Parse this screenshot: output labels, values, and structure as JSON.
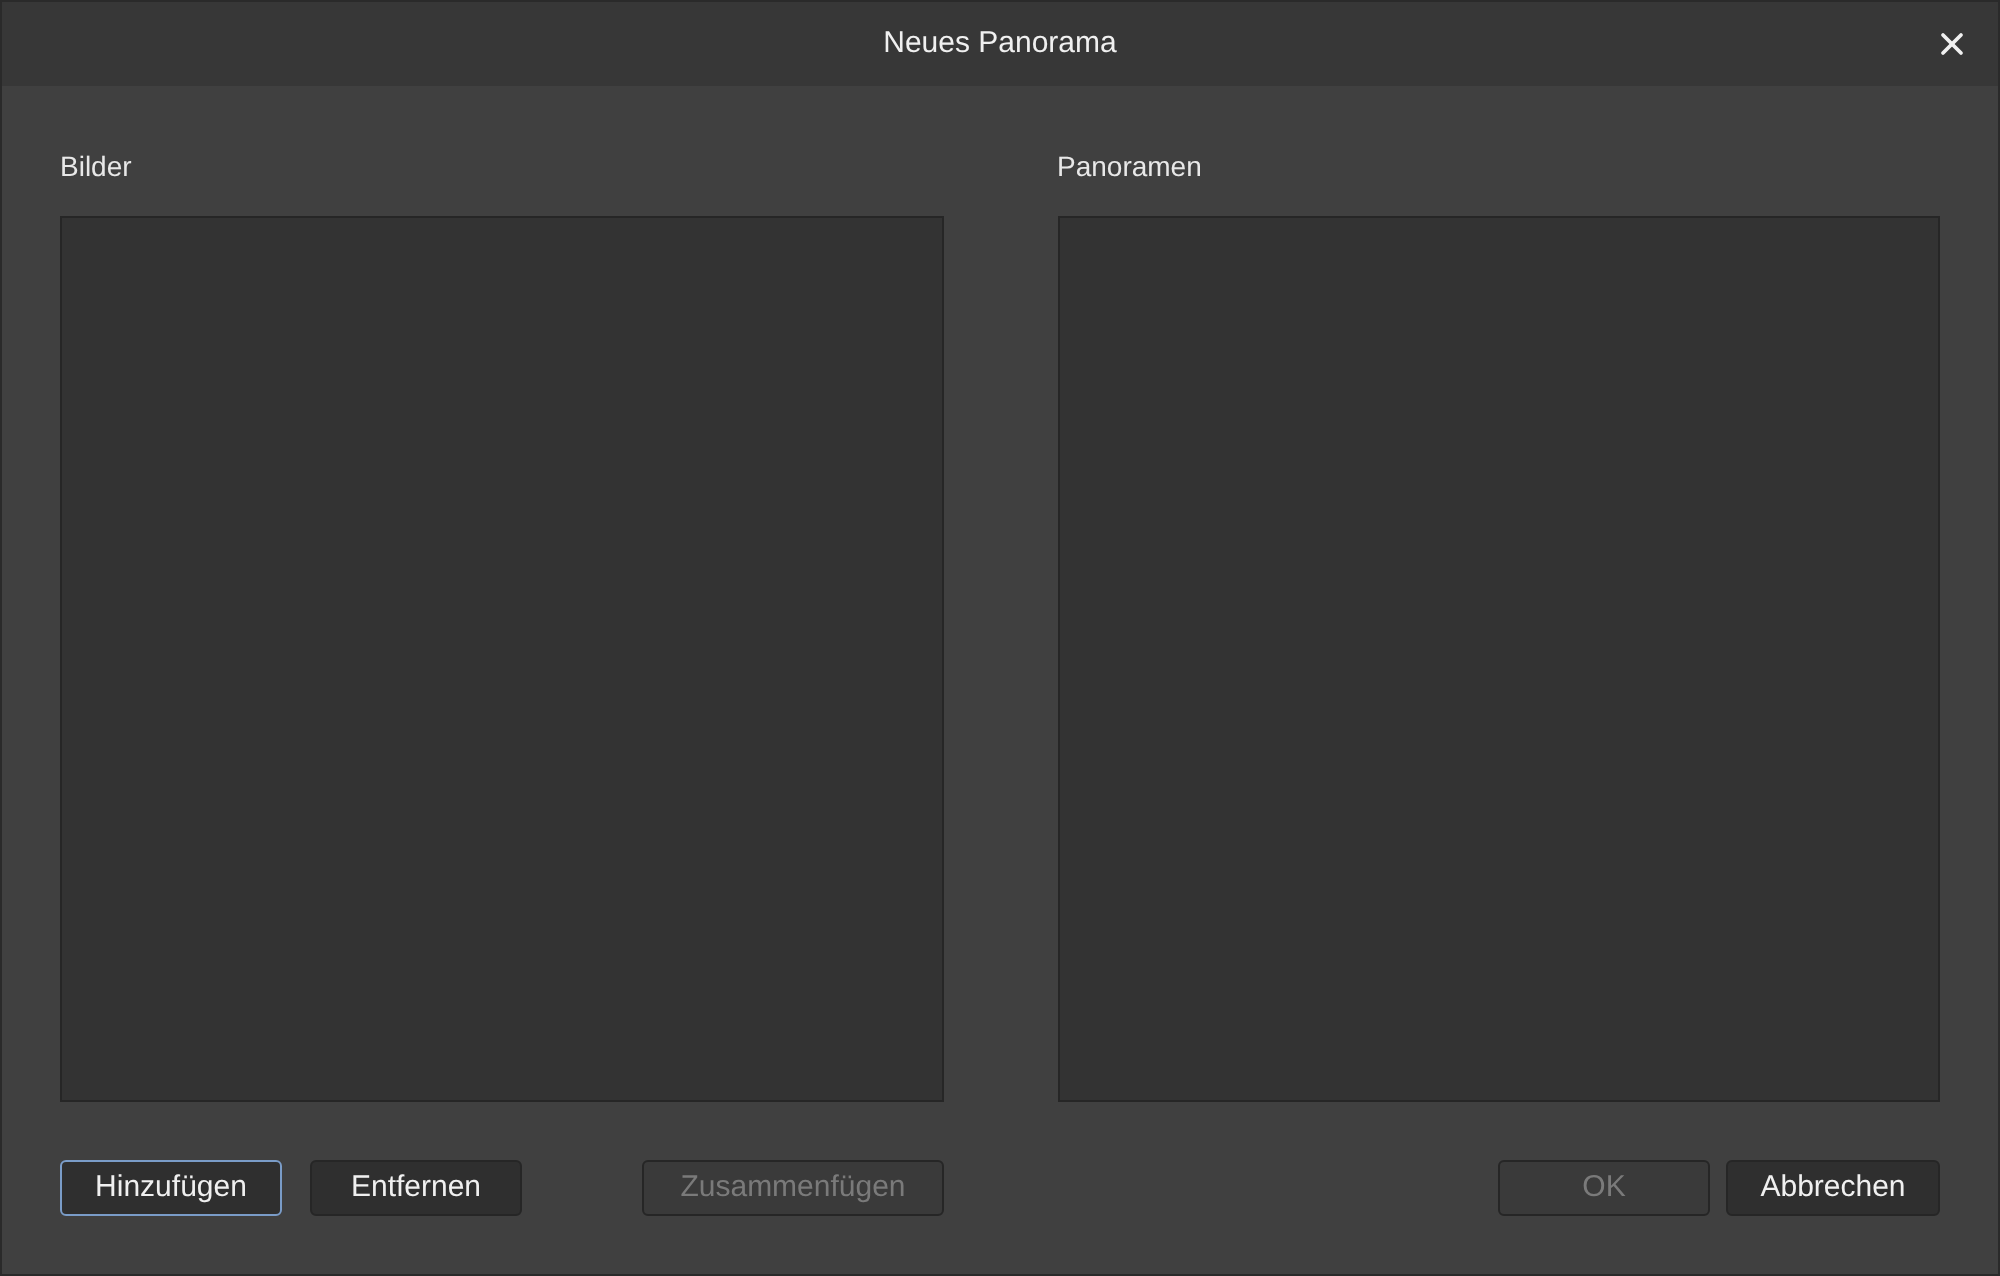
{
  "window": {
    "title": "Neues Panorama"
  },
  "lists": [
    {
      "label": "Bilder"
    },
    {
      "label": "Panoramen"
    }
  ],
  "left_buttons": [
    {
      "label": "Hinzufügen",
      "disabled": false,
      "focused": true
    },
    {
      "label": "Entfernen",
      "disabled": false,
      "focused": false
    },
    {
      "label": "Zusammenfügen",
      "disabled": true,
      "focused": false
    }
  ],
  "right_buttons": [
    {
      "label": "OK",
      "disabled": true,
      "focused": false
    },
    {
      "label": "Abbrechen",
      "disabled": false,
      "focused": false
    }
  ]
}
